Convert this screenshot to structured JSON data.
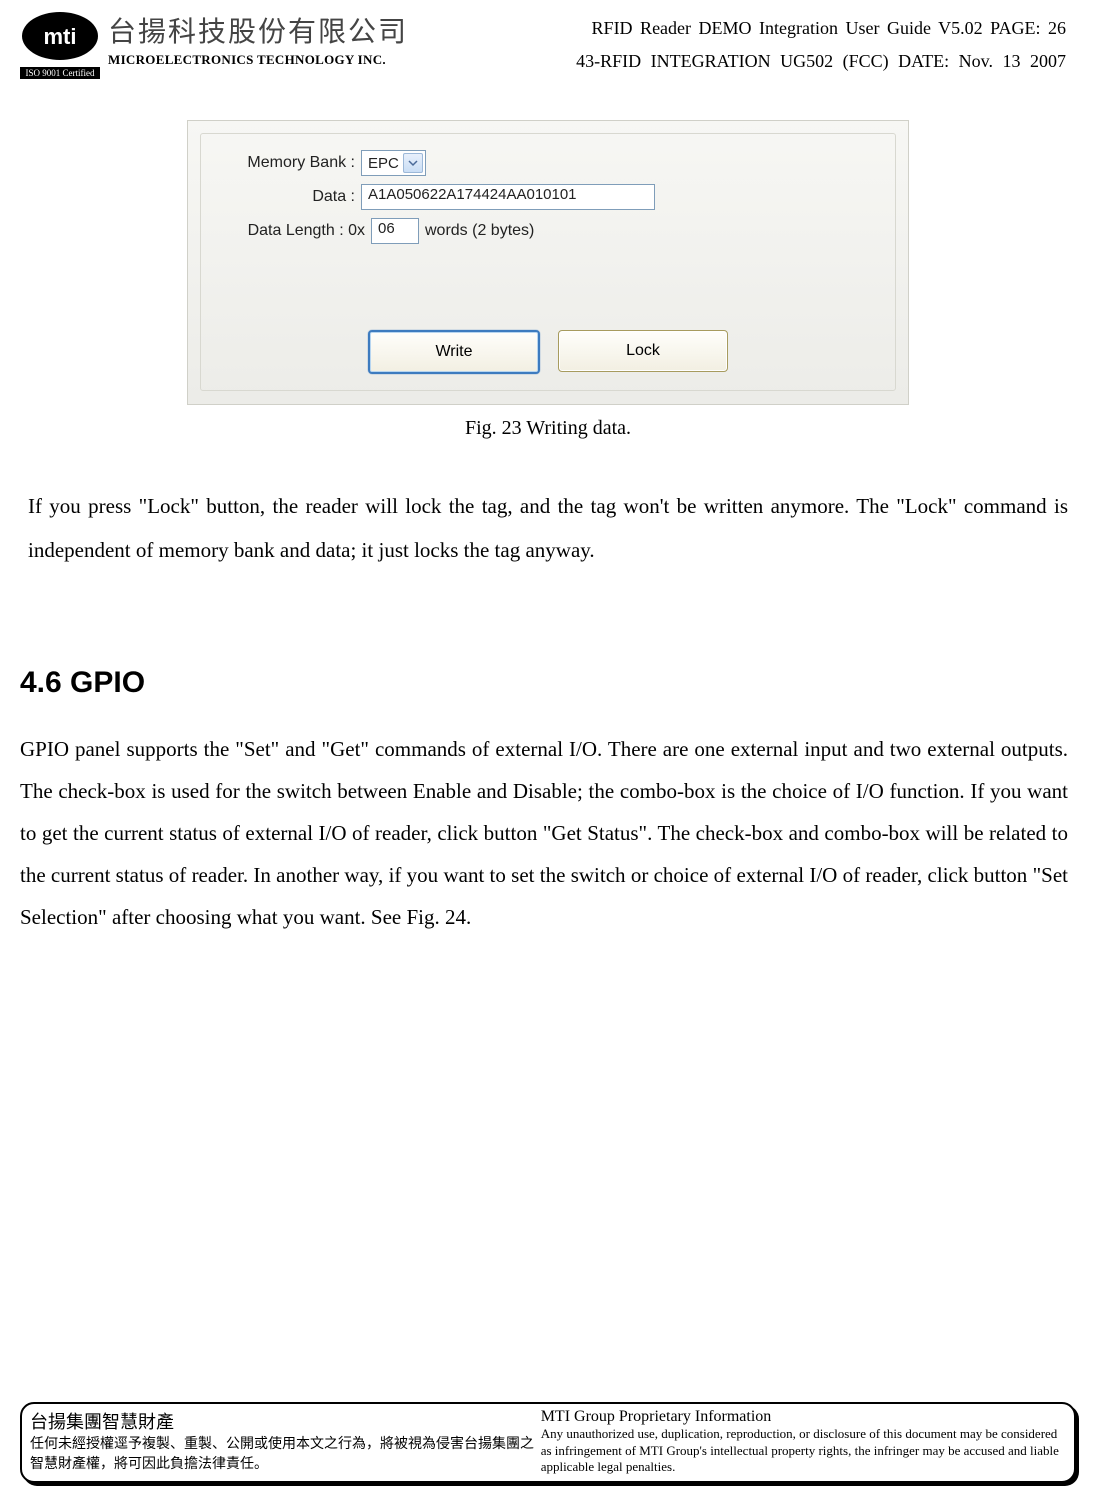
{
  "header": {
    "company_cn": "台揚科技股份有限公司",
    "company_en": "MICROELECTRONICS TECHNOLOGY INC.",
    "iso": "ISO 9001 Certified",
    "doc_line1": "RFID Reader DEMO Integration User Guide V5.02  PAGE: 26",
    "doc_line2": "43-RFID INTEGRATION UG502 (FCC)   DATE: Nov. 13 2007"
  },
  "panel": {
    "memory_bank_label": "Memory Bank :",
    "memory_bank_value": "EPC",
    "data_label": "Data :",
    "data_value": "A1A050622A174424AA010101",
    "data_length_label": "Data Length : 0x",
    "data_length_value": "06",
    "data_length_suffix": "words (2 bytes)",
    "write_btn": "Write",
    "lock_btn": "Lock"
  },
  "caption": "Fig. 23    Writing data.",
  "para1": "If you press \"Lock\" button, the reader will lock the tag, and the tag won't be written anymore.    The \"Lock\" command is independent of memory bank and data; it just locks the tag anyway.",
  "section_heading": "4.6  GPIO",
  "para2": "GPIO panel supports the \"Set\" and \"Get\" commands of external I/O. There are one external input and two external outputs. The check-box is used for the switch between Enable and Disable; the combo-box is the choice of I/O function. If you want to get the current status of external I/O of reader, click button \"Get Status\". The check-box and combo-box will be related to the current status of reader. In another way, if you want to set the switch or choice of external I/O of reader, click button \"Set Selection\" after choosing what you want. See Fig. 24.",
  "footer": {
    "cn_title": "台揚集團智慧財產",
    "cn_body": "任何未經授權逕予複製、重製、公開或使用本文之行為，將被視為侵害台揚集團之智慧財產權，將可因此負擔法律責任。",
    "en_title": "MTI Group Proprietary Information",
    "en_body": "Any unauthorized use, duplication, reproduction, or disclosure of this document may be considered as infringement of MTI Group's intellectual property rights, the infringer may be accused and liable applicable legal penalties."
  }
}
